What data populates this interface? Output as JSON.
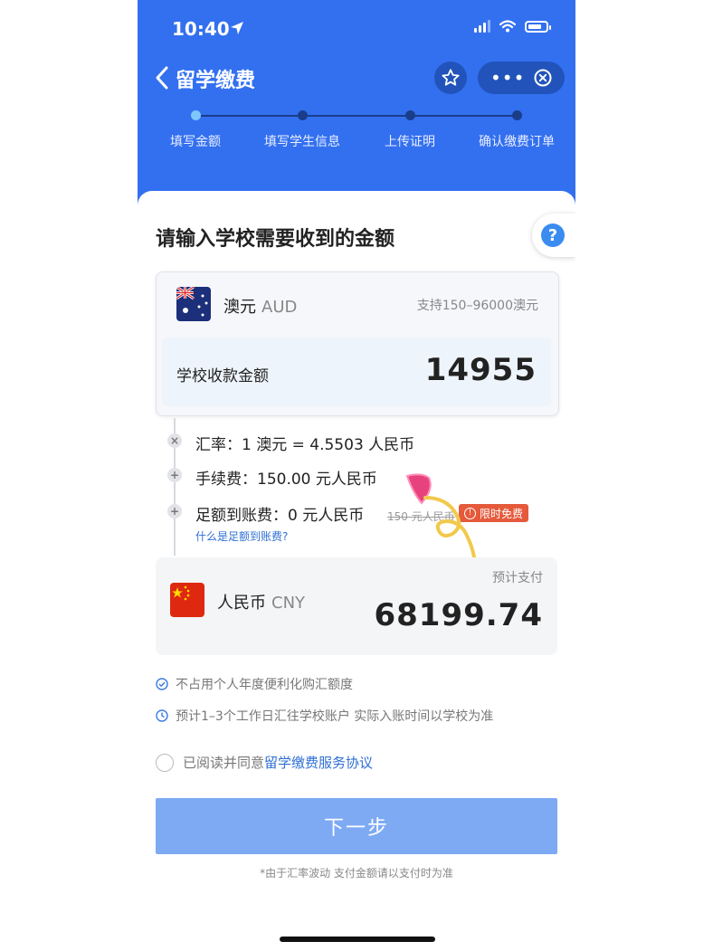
{
  "status_bar": {
    "time": "10:40"
  },
  "nav": {
    "title": "留学缴费",
    "more": "•••"
  },
  "steps": [
    {
      "label": "填写金额",
      "active": true
    },
    {
      "label": "填写学生信息",
      "active": false
    },
    {
      "label": "上传证明",
      "active": false
    },
    {
      "label": "确认缴费订单",
      "active": false
    }
  ],
  "page": {
    "title": "请输入学校需要收到的金额",
    "help": "?"
  },
  "source_currency": {
    "name": "澳元",
    "code": "AUD",
    "range_note": "支持150–96000澳元"
  },
  "amount": {
    "label": "学校收款金额",
    "value": "14955"
  },
  "fees": {
    "rate_mark": "×",
    "rate": "汇率：1 澳元 = 4.5503 人民币",
    "service_mark": "+",
    "service": "手续费：150.00 元人民币",
    "arrival_mark": "+",
    "arrival": "足额到账费：0 元人民币",
    "arrival_original": "150 元人民币",
    "free_badge": "限时免费",
    "free_badge_icon": "!",
    "help_link": "什么是足额到账费?"
  },
  "target_currency": {
    "name": "人民币",
    "code": "CNY",
    "est_label": "预计支付",
    "est_value": "68199.74"
  },
  "notes": [
    "不占用个人年度便利化购汇额度",
    "预计1–3个工作日汇往学校账户 实际入账时间以学校为准"
  ],
  "agreement": {
    "prefix": "已阅读并同意",
    "link": "留学缴费服务协议"
  },
  "next_button": "下一步",
  "footnote": "*由于汇率波动 支付金额请以支付时为准",
  "colors": {
    "header_blue": "#3370f0",
    "button_blue": "#7eaaf4",
    "link_blue": "#2f6fd3",
    "badge_red": "#e55a3b"
  }
}
